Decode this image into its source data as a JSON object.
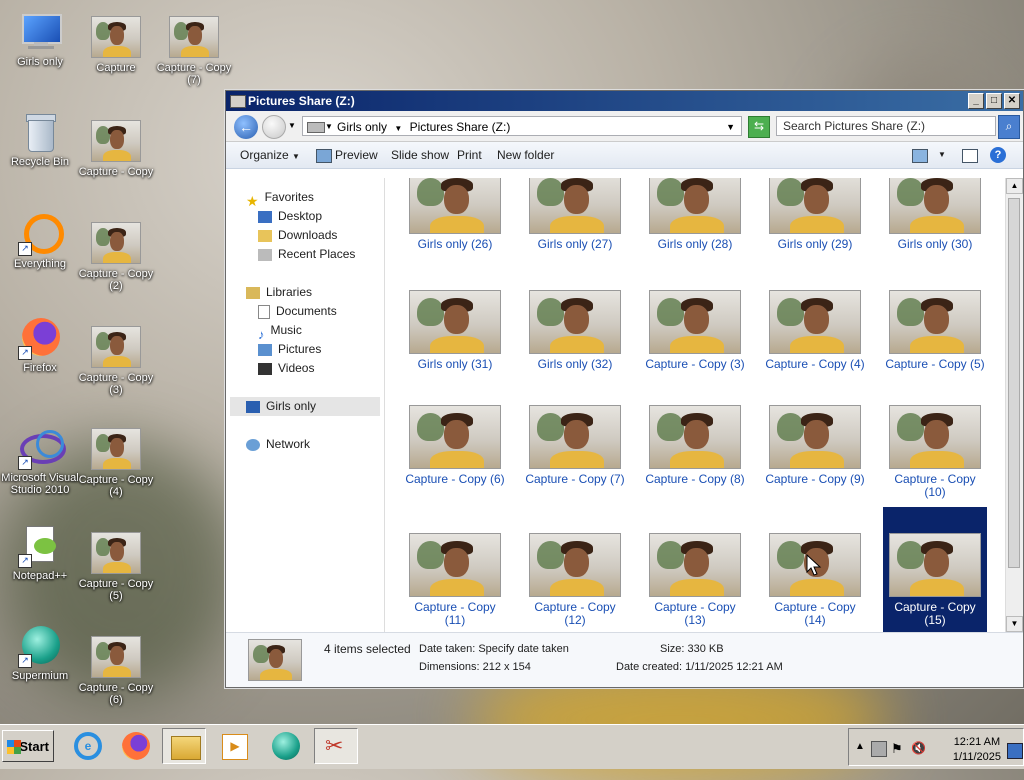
{
  "desktop": {
    "icons": [
      {
        "label": "Girls only"
      },
      {
        "label": "Capture"
      },
      {
        "label": "Capture - Copy (7)"
      },
      {
        "label": "Recycle Bin"
      },
      {
        "label": "Capture - Copy"
      },
      {
        "label": "Everything"
      },
      {
        "label": "Capture - Copy (2)"
      },
      {
        "label": "Firefox"
      },
      {
        "label": "Capture - Copy (3)"
      },
      {
        "label": "Microsoft Visual Studio 2010"
      },
      {
        "label": "Capture - Copy (4)"
      },
      {
        "label": "Notepad++"
      },
      {
        "label": "Capture - Copy (5)"
      },
      {
        "label": "Supermium"
      },
      {
        "label": "Capture - Copy (6)"
      }
    ]
  },
  "window": {
    "title": "Pictures Share (Z:)",
    "breadcrumb": [
      "Girls only",
      "Pictures Share (Z:)"
    ],
    "search_placeholder": "Search Pictures Share (Z:)",
    "toolbar": {
      "organize": "Organize",
      "preview": "Preview",
      "slideshow": "Slide show",
      "print": "Print",
      "new_folder": "New folder"
    },
    "nav": {
      "favorites": "Favorites",
      "desktop": "Desktop",
      "downloads": "Downloads",
      "recent": "Recent Places",
      "libraries": "Libraries",
      "documents": "Documents",
      "music": "Music",
      "pictures": "Pictures",
      "videos": "Videos",
      "girls_only": "Girls only",
      "network": "Network"
    },
    "files": [
      {
        "label": "Girls only (26)"
      },
      {
        "label": "Girls only (27)"
      },
      {
        "label": "Girls only (28)"
      },
      {
        "label": "Girls only (29)"
      },
      {
        "label": "Girls only (30)"
      },
      {
        "label": "Girls only (31)"
      },
      {
        "label": "Girls only (32)"
      },
      {
        "label": "Capture - Copy (3)"
      },
      {
        "label": "Capture - Copy (4)"
      },
      {
        "label": "Capture - Copy (5)"
      },
      {
        "label": "Capture - Copy (6)"
      },
      {
        "label": "Capture - Copy (7)"
      },
      {
        "label": "Capture - Copy (8)"
      },
      {
        "label": "Capture - Copy (9)"
      },
      {
        "label": "Capture - Copy (10)"
      },
      {
        "label": "Capture - Copy (11)"
      },
      {
        "label": "Capture - Copy (12)"
      },
      {
        "label": "Capture - Copy (13)"
      },
      {
        "label": "Capture - Copy (14)"
      },
      {
        "label": "Capture - Copy (15)",
        "selected": true
      }
    ],
    "details": {
      "selected_count": "4 items selected",
      "date_taken": "Date taken: Specify date taken",
      "size": "Size: 330 KB",
      "dimensions": "Dimensions: 212 x 154",
      "date_created": "Date created: 1/11/2025 12:21 AM"
    }
  },
  "taskbar": {
    "start": "Start",
    "time": "12:21 AM",
    "date": "1/11/2025"
  }
}
